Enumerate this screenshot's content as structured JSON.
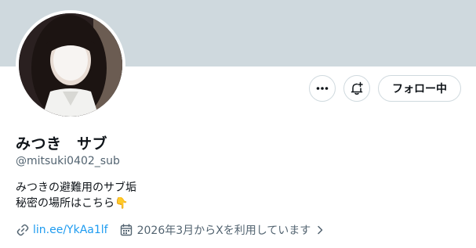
{
  "profile": {
    "display_name": "みつき　サブ",
    "handle": "@mitsuki0402_sub",
    "bio_line1": "みつきの避難用のサブ垢",
    "bio_line2": "秘密の場所はこちら",
    "bio_emoji": "👇",
    "link": "lin.ee/YkAa1lf",
    "joined": "2026年3月からXを利用しています"
  },
  "actions": {
    "more_icon": "more-horizontal-icon",
    "notify_icon": "bell-plus-icon",
    "follow_label": "フォロー中"
  },
  "colors": {
    "banner": "#cfd9de",
    "link": "#1d9bf0",
    "secondary_text": "#536471"
  }
}
